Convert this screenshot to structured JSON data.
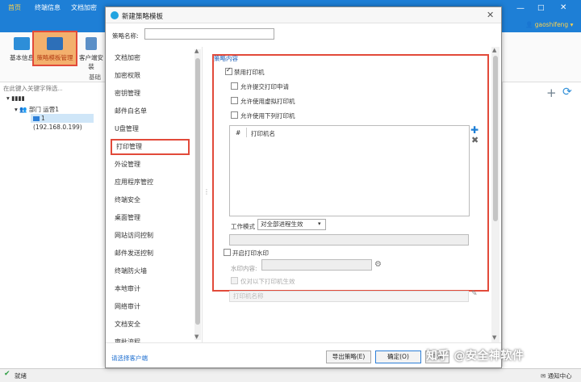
{
  "app": {
    "tabs": [
      "首页",
      "终端信息",
      "文档加密"
    ],
    "ribbon": {
      "basic_label": "基本信息",
      "policy_label": "策略模板管理",
      "client_label": "客户端安装",
      "group_label": "基础"
    },
    "filter_placeholder": "在此键入关键字筛选...",
    "tree": {
      "root_label": "▾ ▮▮▮▮",
      "dept_label": "部门 运营1",
      "node_label": "1 (192.168.0.199)"
    },
    "user": "gaoshifeng",
    "status": "就绪",
    "notify": "通知中心",
    "window_controls": {
      "minimize": "—",
      "maximize": "□",
      "close": "✕"
    }
  },
  "dialog": {
    "title": "新建策略模板",
    "close_glyph": "✕",
    "name_label": "策略名称:",
    "name_value": "",
    "nav_items": [
      "文档加密",
      "加密权限",
      "密钥管理",
      "邮件白名单",
      "U盘管理",
      "打印管理",
      "外设管理",
      "应用程序管控",
      "终端安全",
      "桌面管理",
      "网站访问控制",
      "邮件发送控制",
      "终端防火墙",
      "本地审计",
      "网络审计",
      "文档安全",
      "审批流程"
    ],
    "active_nav": "打印管理",
    "section_title": "策略内容",
    "checkboxes": [
      {
        "label": "禁用打印机",
        "checked": true
      },
      {
        "label": "允许提交打印申请",
        "checked": false
      },
      {
        "label": "允许使用虚拟打印机",
        "checked": false
      },
      {
        "label": "允许使用下列打印机",
        "checked": false
      }
    ],
    "table": {
      "col_index": "#",
      "col_name": "打印机名"
    },
    "work_mode_label": "工作模式",
    "work_mode_value": "对全部进程生效",
    "watermark_checkbox": {
      "label": "开启打印水印",
      "checked": false
    },
    "watermark_content_label": "水印内容:",
    "watermark_content_value": "",
    "only_printers_checkbox": {
      "label": "仅对以下打印机生效",
      "checked": false
    },
    "printer_name_placeholder": "打印机名称",
    "choose_client_link": "请选择客户端",
    "buttons": {
      "export": "导出策略(E)",
      "ok": "确定(O)",
      "cancel": "取消"
    }
  },
  "overlay_watermark": "知乎 @安全神软件",
  "colors": {
    "accent": "#1e7fd6",
    "highlight": "#e24a3a",
    "link": "#1e6fd0"
  },
  "icons": {
    "add": "plus-icon",
    "remove": "x-icon",
    "refresh": "refresh-icon",
    "gear": "gear-icon",
    "edit": "pencil-icon"
  }
}
